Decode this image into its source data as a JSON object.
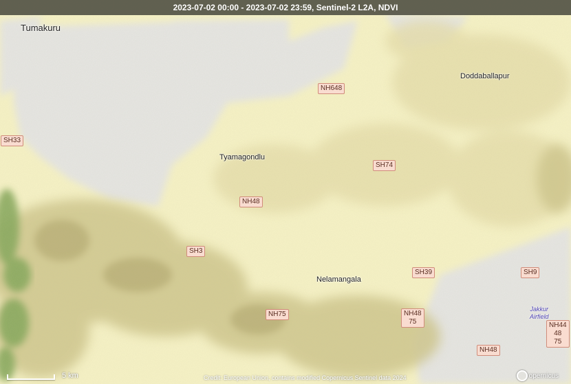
{
  "header": {
    "title": "2023-07-02 00:00 - 2023-07-02 23:59, Sentinel-2 L2A, NDVI"
  },
  "places": {
    "tumakuru": "Tumakuru",
    "doddaballapur": "Doddaballapur",
    "tyamagondlu": "Tyamagondlu",
    "nelamangala": "Nelamangala",
    "jakkur_line1": "Jakkur",
    "jakkur_line2": "Airfield"
  },
  "roads": {
    "nh648": "NH648",
    "sh33": "SH33",
    "sh74": "SH74",
    "nh48_a": "NH48",
    "sh3": "SH3",
    "sh39": "SH39",
    "sh9": "SH9",
    "nh75": "NH75",
    "nh48_75": "NH48\n75",
    "nh44_48_75": "NH44\n48\n75",
    "nh48_b": "NH48"
  },
  "scale": {
    "label": "5 km"
  },
  "credit": "Credit: European Union, contains modified Copernicus Sentinel data 2024",
  "logo": {
    "text": "opernicus"
  },
  "colors": {
    "base_land": "#f7f3c6",
    "cloud": "#e6e6e4",
    "sparse_veg": "#d9d3a0",
    "moderate_veg": "#b8b080",
    "dense_veg": "#7fa45a",
    "shield_bg": "#f9dcd0"
  }
}
